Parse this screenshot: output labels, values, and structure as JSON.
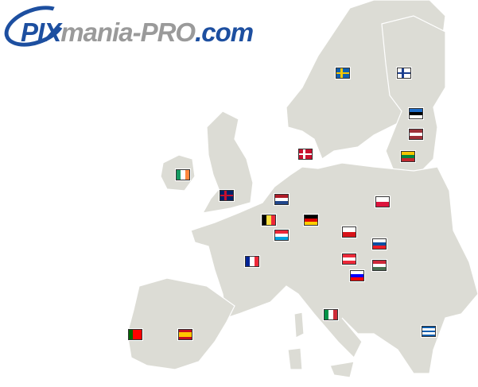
{
  "logo": {
    "part1": "PIX",
    "part2": "mania-PRO",
    "part3": ".com"
  },
  "colors": {
    "land": "#dcdcd5",
    "brand_blue": "#1d4fa0",
    "brand_gray": "#9a9a9a"
  },
  "flags": [
    {
      "icon": "flag-sweden",
      "dir": "cross",
      "colors": [
        "#1060b0",
        "#f5c800"
      ]
    },
    {
      "icon": "flag-finland",
      "dir": "cross",
      "colors": [
        "#ffffff",
        "#1c3f8f"
      ]
    },
    {
      "icon": "flag-estonia",
      "dir": "h",
      "colors": [
        "#1d6cc8",
        "#000000",
        "#ffffff"
      ]
    },
    {
      "icon": "flag-latvia",
      "dir": "h",
      "colors": [
        "#9e3039",
        "#ffffff",
        "#9e3039"
      ]
    },
    {
      "icon": "flag-lithuania",
      "dir": "h",
      "colors": [
        "#f5c400",
        "#00843d",
        "#c1272d"
      ]
    },
    {
      "icon": "flag-denmark",
      "dir": "cross",
      "colors": [
        "#c8102e",
        "#ffffff"
      ]
    },
    {
      "icon": "flag-ireland",
      "dir": "v",
      "colors": [
        "#169b62",
        "#ffffff",
        "#ff883e"
      ]
    },
    {
      "icon": "flag-united-kingdom",
      "dir": "cross",
      "colors": [
        "#012169",
        "#c8102e"
      ]
    },
    {
      "icon": "flag-netherlands",
      "dir": "h",
      "colors": [
        "#ae1c28",
        "#ffffff",
        "#21468b"
      ]
    },
    {
      "icon": "flag-belgium",
      "dir": "v",
      "colors": [
        "#000000",
        "#fae042",
        "#ed2939"
      ]
    },
    {
      "icon": "flag-germany",
      "dir": "h",
      "colors": [
        "#000000",
        "#dd0000",
        "#ffce00"
      ]
    },
    {
      "icon": "flag-luxembourg",
      "dir": "h",
      "colors": [
        "#ed2939",
        "#ffffff",
        "#00a1de"
      ]
    },
    {
      "icon": "flag-poland",
      "dir": "h",
      "colors": [
        "#ffffff",
        "#dc143c"
      ]
    },
    {
      "icon": "flag-czech-republic",
      "dir": "h",
      "colors": [
        "#ffffff",
        "#d7141a"
      ]
    },
    {
      "icon": "flag-slovakia",
      "dir": "h",
      "colors": [
        "#ffffff",
        "#0b4ea2",
        "#ee1c25"
      ]
    },
    {
      "icon": "flag-france",
      "dir": "v",
      "colors": [
        "#002395",
        "#ffffff",
        "#ed2939"
      ]
    },
    {
      "icon": "flag-austria",
      "dir": "h",
      "colors": [
        "#ed2939",
        "#ffffff",
        "#ed2939"
      ]
    },
    {
      "icon": "flag-hungary",
      "dir": "h",
      "colors": [
        "#ce2939",
        "#ffffff",
        "#477050"
      ]
    },
    {
      "icon": "flag-slovenia",
      "dir": "h",
      "colors": [
        "#ffffff",
        "#0000ff",
        "#ff0000"
      ]
    },
    {
      "icon": "flag-italy",
      "dir": "v",
      "colors": [
        "#009246",
        "#ffffff",
        "#ce2b37"
      ]
    },
    {
      "icon": "flag-portugal",
      "dir": "v",
      "colors": [
        "#006600",
        "#ff0000",
        "#ff0000"
      ]
    },
    {
      "icon": "flag-spain",
      "dir": "h",
      "colors": [
        "#c60b1e",
        "#ffc400",
        "#ffc400",
        "#c60b1e"
      ]
    },
    {
      "icon": "flag-greece",
      "dir": "h",
      "colors": [
        "#0d5eaf",
        "#ffffff",
        "#0d5eaf",
        "#ffffff",
        "#0d5eaf"
      ]
    }
  ]
}
